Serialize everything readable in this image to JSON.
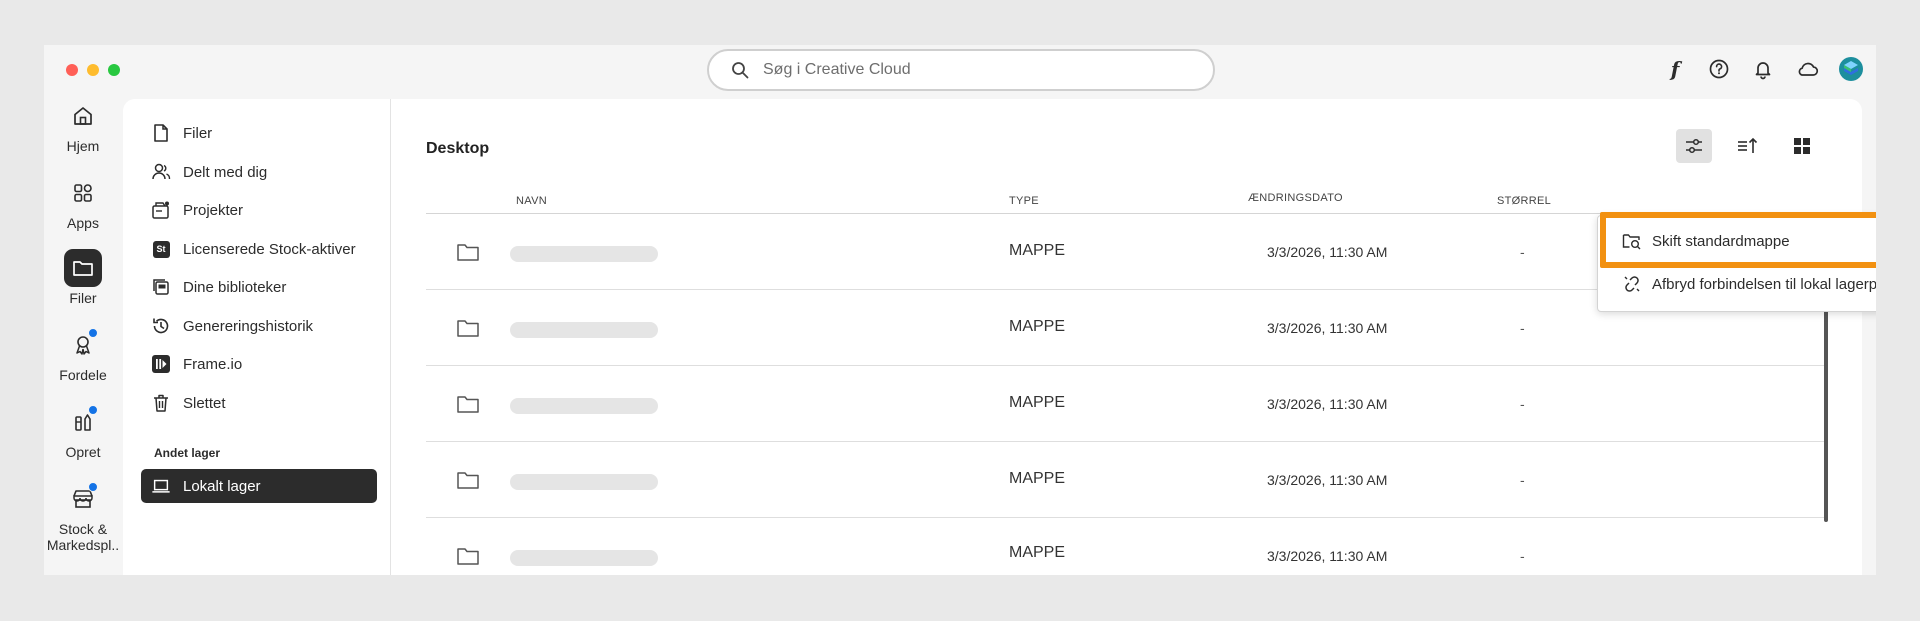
{
  "colors": {
    "close": "#ff5f57",
    "minimize": "#febc2e",
    "zoom": "#28c840",
    "accent_blue": "#1473e6",
    "highlight_orange": "#f29111",
    "dark": "#2c2c2c"
  },
  "search": {
    "placeholder": "Søg i Creative Cloud"
  },
  "topbar_icons": [
    "font-icon",
    "help-icon",
    "bell-icon",
    "cloud-icon",
    "avatar"
  ],
  "rail": {
    "items": [
      {
        "label": "Hjem",
        "icon": "home-icon"
      },
      {
        "label": "Apps",
        "icon": "apps-icon"
      },
      {
        "label": "Filer",
        "icon": "folder-icon",
        "active": true
      },
      {
        "label": "Fordele",
        "icon": "ribbon-icon",
        "badge": true
      },
      {
        "label": "Opret",
        "icon": "create-icon",
        "badge": true
      },
      {
        "label": "Stock &",
        "label2": "Markedspl..",
        "icon": "store-icon",
        "badge": true
      }
    ]
  },
  "sidenav": {
    "items": [
      {
        "label": "Filer",
        "icon": "file-icon"
      },
      {
        "label": "Delt med dig",
        "icon": "shared-icon"
      },
      {
        "label": "Projekter",
        "icon": "projects-icon"
      },
      {
        "label": "Licenserede Stock-aktiver",
        "icon": "stock-icon"
      },
      {
        "label": "Dine biblioteker",
        "icon": "libraries-icon"
      },
      {
        "label": "Genereringshistorik",
        "icon": "history-icon"
      },
      {
        "label": "Frame.io",
        "icon": "frameio-icon"
      },
      {
        "label": "Slettet",
        "icon": "trash-icon"
      }
    ],
    "section_label": "Andet lager",
    "local_storage_label": "Lokalt lager"
  },
  "main": {
    "title": "Desktop",
    "columns": {
      "name": "NAVN",
      "type": "TYPE",
      "date": "ÆNDRINGSDATO",
      "size": "STØRREL"
    },
    "rows": [
      {
        "type": "MAPPE",
        "date": "3/3/2026, 11:30 AM",
        "size": "-"
      },
      {
        "type": "MAPPE",
        "date": "3/3/2026, 11:30 AM",
        "size": "-"
      },
      {
        "type": "MAPPE",
        "date": "3/3/2026, 11:30 AM",
        "size": "-"
      },
      {
        "type": "MAPPE",
        "date": "3/3/2026, 11:30 AM",
        "size": "-"
      },
      {
        "type": "MAPPE",
        "date": "3/3/2026, 11:30 AM",
        "size": "-"
      }
    ]
  },
  "menu": {
    "items": [
      {
        "label": "Skift standardmappe",
        "icon": "change-folder-icon",
        "highlighted": true
      },
      {
        "label": "Afbryd forbindelsen til lokal lagerplads",
        "icon": "unlink-icon"
      }
    ]
  }
}
